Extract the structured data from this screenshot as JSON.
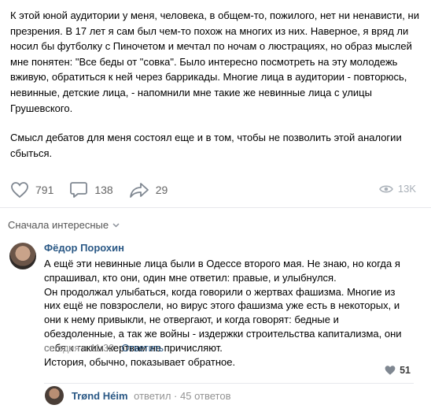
{
  "post": {
    "paragraph1": "К этой юной аудитории у меня, человека, в общем-то, пожилого, нет ни ненависти, ни презрения. В 17 лет я сам был чем-то похож на многих из них. Наверное, я вряд ли носил бы футболку с Пиночетом и мечтал по ночам о люстрациях, но образ мыслей мне понятен: \"Все беды от \"совка\". Было интересно посмотреть на эту молодежь вживую, обратиться к ней через баррикады. Многие лица в аудитории - повторюсь, невинные, детские лица, - напомнили мне такие же невинные лица с улицы Грушевского.",
    "paragraph2": "Смысл дебатов для меня состоял еще и в том, чтобы не позволить этой аналогии сбыться.",
    "likes": "791",
    "comments": "138",
    "shares": "29",
    "views": "13K",
    "icons": {
      "like": "heart-icon",
      "comment": "comment-icon",
      "share": "share-icon",
      "views": "eye-icon"
    }
  },
  "comments": {
    "sort_label": "Сначала интересные",
    "items": [
      {
        "author": "Фёдор Порохин",
        "lines": [
          "А ещё эти невинные лица были в Одессе второго мая. Не знаю, но когда я",
          "спрашивал, кто они, один мне ответил: правые, и улыбнулся.",
          "Он продолжал улыбаться, когда говорили о жертвах фашизма. Многие из",
          "них ещё не повзрослели, но вирус этого фашизма уже есть в некоторых, и",
          "они к нему привыкли, не отвергают, и когда говорят: бедные и",
          "обездоленные, а так же войны - издержки строительства капитализма, они",
          "себя к таким жертвам не причисляют.",
          "История, обычно, показывает обратное."
        ],
        "time": "сегодня в 11:30",
        "reply_label": "Ответить",
        "likes": "51",
        "reply_preview": {
          "author": "Trønd Héim",
          "action": "ответил",
          "separator": "·",
          "count": "45 ответов"
        }
      }
    ]
  }
}
